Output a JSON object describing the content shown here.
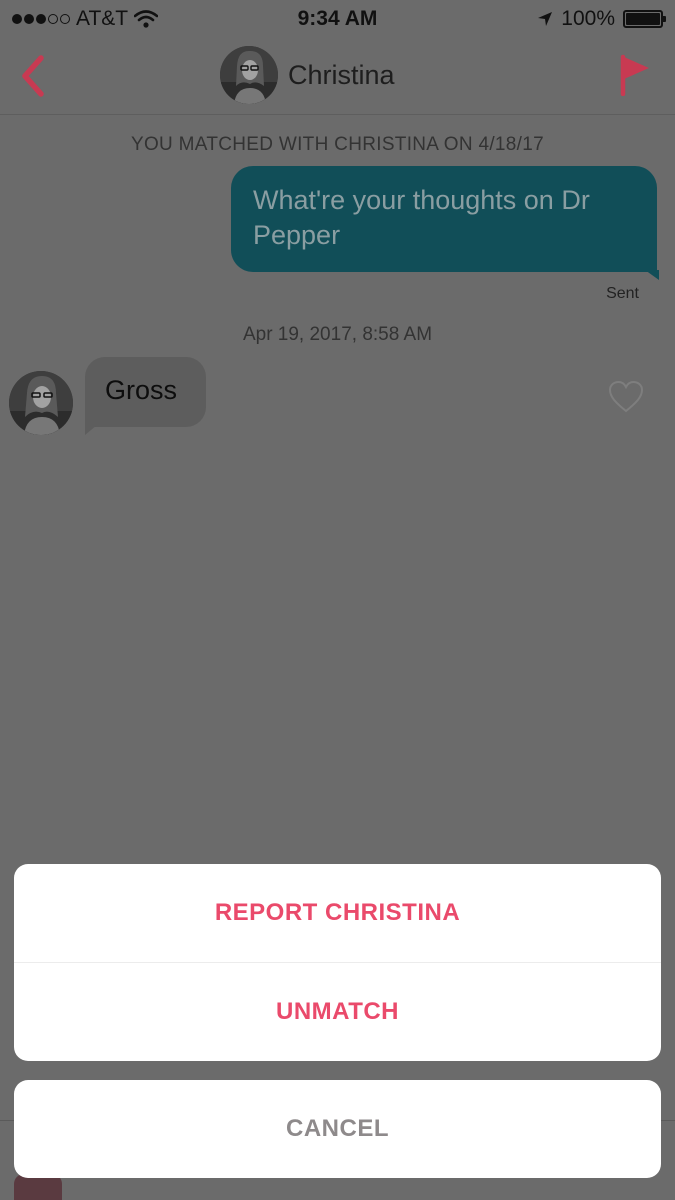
{
  "status_bar": {
    "carrier": "AT&T",
    "signal_bars_filled": 3,
    "signal_bars_total": 5,
    "time": "9:34 AM",
    "battery": "100%"
  },
  "header": {
    "contact_name": "Christina",
    "back_icon": "chevron-left-icon",
    "report_icon": "flag-icon",
    "accent_color": "#c83a52"
  },
  "conversation": {
    "match_note": "YOU MATCHED WITH CHRISTINA ON 4/18/17",
    "outgoing_message": "What're your thoughts on Dr Pepper",
    "sent_status": "Sent",
    "timestamp": "Apr 19, 2017, 8:58 AM",
    "incoming_message": "Gross",
    "like_icon": "heart-outline-icon",
    "outgoing_bubble_color": "#114e58"
  },
  "action_sheet": {
    "report_label": "REPORT CHRISTINA",
    "unmatch_label": "UNMATCH",
    "cancel_label": "CANCEL",
    "destructive_color": "#ea4a6b",
    "cancel_color": "#8e8a8b"
  }
}
